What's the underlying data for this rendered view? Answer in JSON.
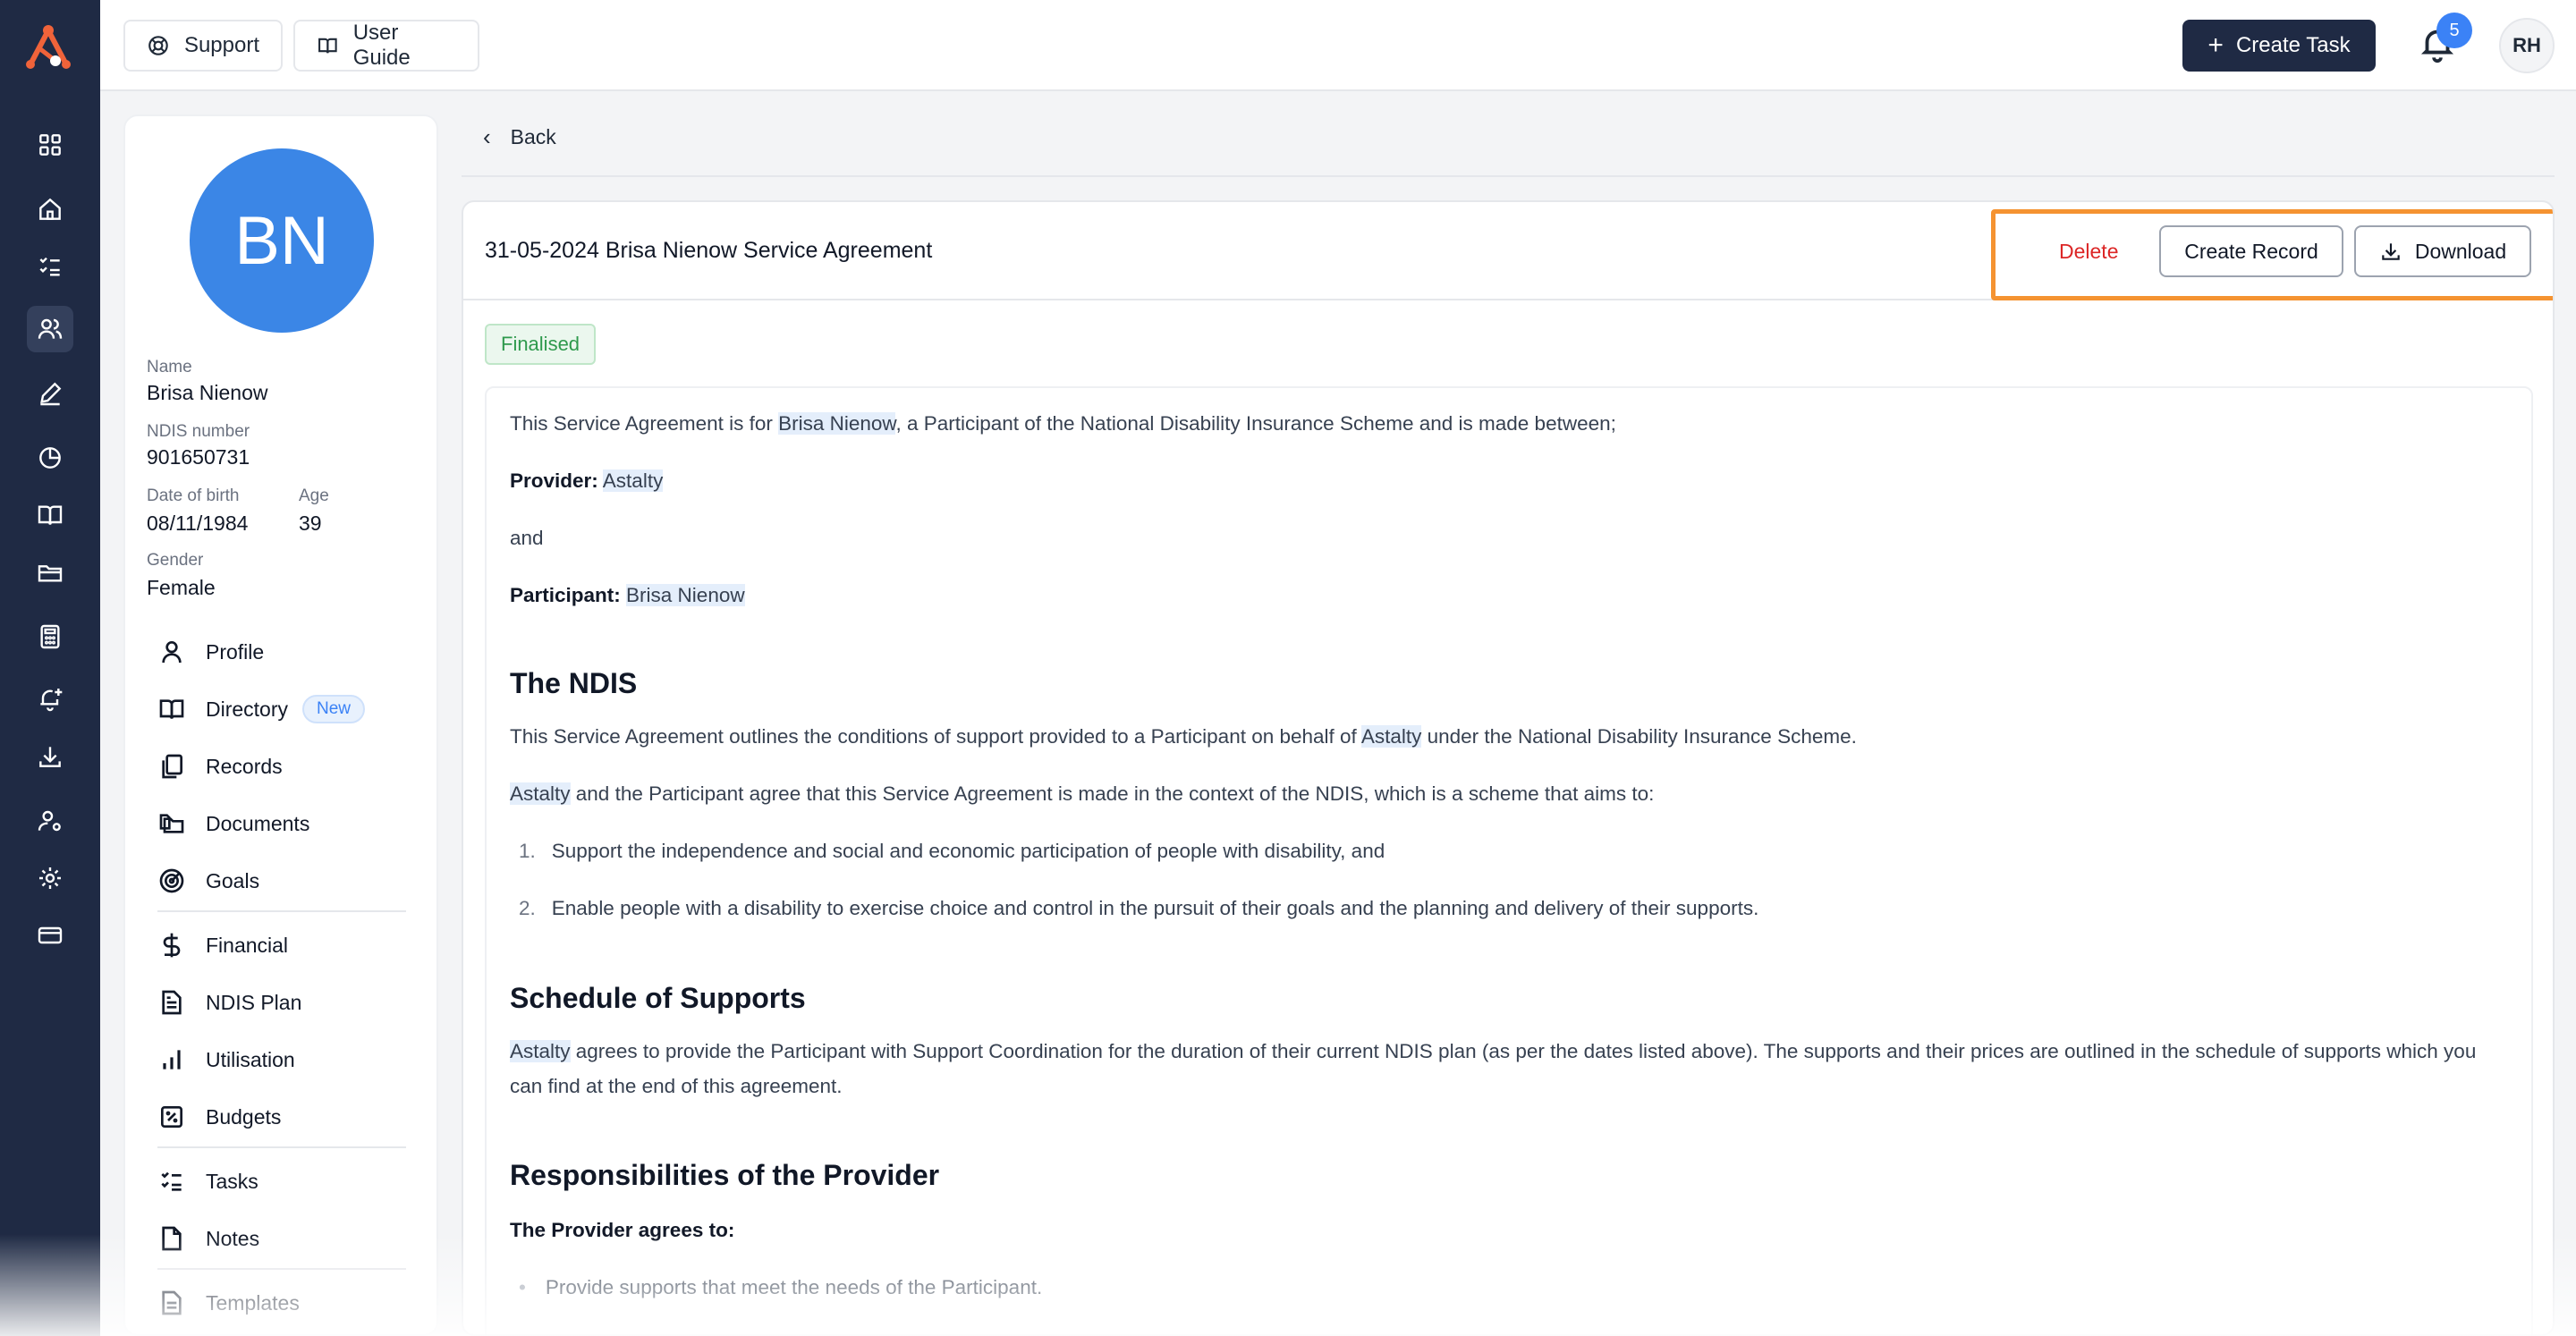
{
  "topbar": {
    "support_label": "Support",
    "guide_label": "User Guide",
    "create_task_label": "Create Task",
    "notification_count": "5",
    "user_initials": "RH"
  },
  "profile": {
    "initials": "BN",
    "name_label": "Name",
    "name": "Brisa Nienow",
    "ndis_label": "NDIS number",
    "ndis": "901650731",
    "dob_label": "Date of birth",
    "dob": "08/11/1984",
    "age_label": "Age",
    "age": "39",
    "gender_label": "Gender",
    "gender": "Female"
  },
  "nav": {
    "profile": "Profile",
    "directory": "Directory",
    "new_badge": "New",
    "records": "Records",
    "documents": "Documents",
    "goals": "Goals",
    "financial": "Financial",
    "ndis_plan": "NDIS Plan",
    "utilisation": "Utilisation",
    "budgets": "Budgets",
    "tasks": "Tasks",
    "notes": "Notes",
    "templates": "Templates"
  },
  "main": {
    "back_label": "Back",
    "title": "31-05-2024 Brisa Nienow Service Agreement",
    "delete_label": "Delete",
    "create_record_label": "Create Record",
    "download_label": "Download",
    "status": "Finalised"
  },
  "doc": {
    "intro_pre": "This Service Agreement is for ",
    "participant": "Brisa Nienow",
    "intro_post": ", a Participant of the National Disability Insurance Scheme and is made between;",
    "provider_label": "Provider:",
    "provider": "Astalty",
    "and": "and",
    "participant_label": "Participant:",
    "h_ndis": "The NDIS",
    "ndis_p1_pre": "This Service Agreement outlines the conditions of support provided to a Participant on behalf of ",
    "ndis_p1_post": " under the National Disability Insurance Scheme.",
    "ndis_p2_post": " and the Participant agree that this Service Agreement is made in the context of the NDIS, which is a scheme that aims to:",
    "list_1": "Support the independence and social and economic participation of people with disability, and",
    "list_2": "Enable people with a disability to exercise choice and control in the pursuit of their goals and the planning and delivery of their supports.",
    "h_schedule": "Schedule of Supports",
    "schedule_post": " agrees to provide the Participant with Support Coordination for the duration of their current NDIS plan (as per the dates listed above). The supports and their prices are outlined in the schedule of supports which you can find at the end of this agreement.",
    "h_resp": "Responsibilities of the Provider",
    "agrees": "The Provider agrees to:",
    "bullet_1": "Provide supports that meet the needs of the Participant."
  },
  "colors": {
    "rail": "#1f2a44",
    "accent_orange": "#f59331",
    "avatar_blue": "#3b86e6",
    "delete_red": "#dc2626",
    "status_green": "#2f9a4d"
  }
}
